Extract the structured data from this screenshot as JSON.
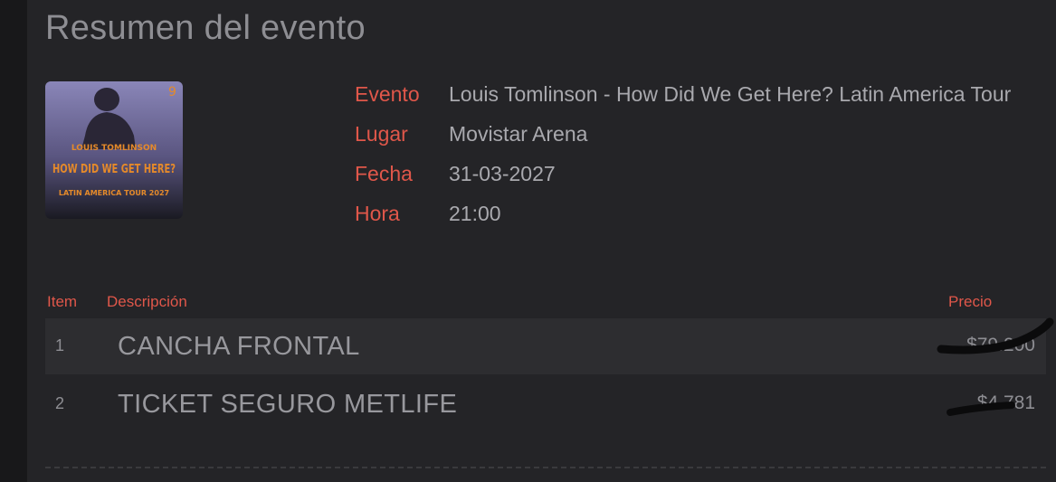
{
  "summary": {
    "title": "Resumen del evento"
  },
  "poster": {
    "artist": "LOUIS TOMLINSON",
    "headline": "HOW DID WE GET HERE?",
    "tour": "LATIN AMERICA TOUR 2027"
  },
  "event": {
    "event_label": "Evento",
    "event_value": "Louis Tomlinson - How Did We Get Here? Latin America Tour",
    "place_label": "Lugar",
    "place_value": "Movistar Arena",
    "date_label": "Fecha",
    "date_value": "31-03-2027",
    "time_label": "Hora",
    "time_value": "21:00"
  },
  "table": {
    "headers": {
      "item": "Item",
      "description": "Descripción",
      "price": "Precio"
    },
    "rows": [
      {
        "item": "1",
        "description": "CANCHA FRONTAL",
        "price": "$79.200"
      },
      {
        "item": "2",
        "description": "TICKET SEGURO METLIFE",
        "price": "$4.781"
      }
    ]
  },
  "colors": {
    "accent": "#e0574a",
    "background": "#242427"
  }
}
